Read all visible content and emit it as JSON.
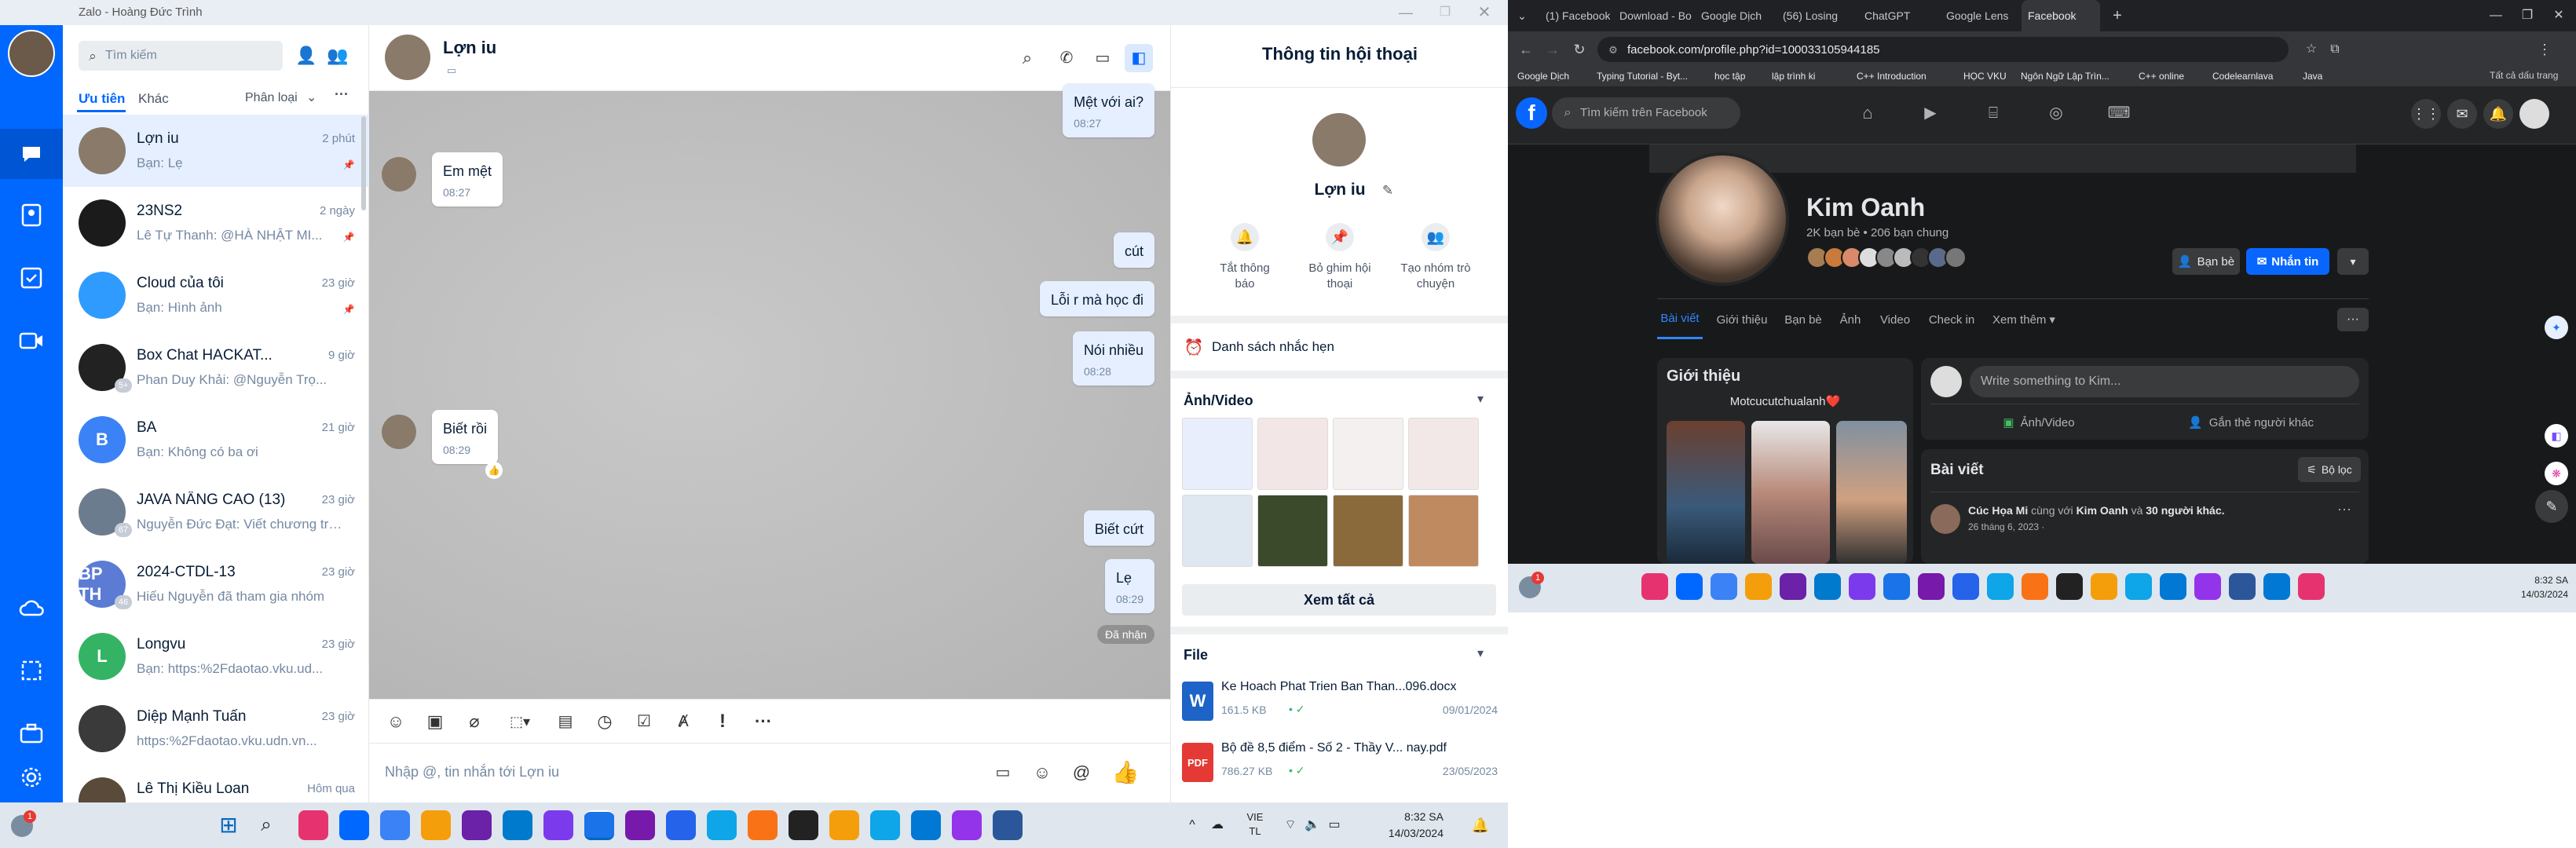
{
  "zalo": {
    "window_title": "Zalo - Hoàng Đức Trình",
    "search_placeholder": "Tìm kiếm",
    "tabs": {
      "priority": "Ưu tiên",
      "other": "Khác",
      "classify": "Phân loại"
    },
    "conversations": [
      {
        "name": "Lợn iu",
        "time": "2 phút",
        "preview": "Bạn: Lẹ",
        "avatar_color": "#8a7a6a",
        "initials": "",
        "pinned": true
      },
      {
        "name": "23NS2",
        "time": "2 ngày",
        "preview": "Lê Tự Thanh: @HÀ NHẬT MI...",
        "avatar_color": "#1b1b1b",
        "initials": "",
        "pinned": true
      },
      {
        "name": "Cloud của tôi",
        "time": "23 giờ",
        "preview": "Bạn: Hình ảnh",
        "avatar_color": "#2f9bff",
        "initials": "",
        "pinned": true
      },
      {
        "name": "Box Chat HACKAT...",
        "time": "9 giờ",
        "preview": "Phan Duy Khải: @Nguyễn Trọ...",
        "avatar_color": "#222222",
        "initials": "",
        "badge": "5+"
      },
      {
        "name": "BA",
        "time": "21 giờ",
        "preview": "Bạn: Không có ba ơi",
        "avatar_color": "#3b82f6",
        "initials": "B"
      },
      {
        "name": "JAVA NÂNG CAO (13)",
        "time": "23 giờ",
        "preview": "Nguyễn Đức Đạt: Viết chương trì...",
        "avatar_color": "#6b7c8f",
        "initials": "",
        "badge": "67"
      },
      {
        "name": "2024-CTDL-13",
        "time": "23 giờ",
        "preview": "Hiếu Nguyễn đã tham gia nhóm",
        "avatar_color": "#5b7bd5",
        "initials": "BP TH",
        "badge": "46"
      },
      {
        "name": "Longvu",
        "time": "23 giờ",
        "preview": "Bạn: https:%2Fdaotao.vku.ud...",
        "avatar_color": "#34b364",
        "initials": "L"
      },
      {
        "name": "Diệp Mạnh Tuấn",
        "time": "23 giờ",
        "preview": "https:%2Fdaotao.vku.udn.vn...",
        "avatar_color": "#3a3a3a",
        "initials": ""
      },
      {
        "name": "Lê Thị Kiều Loan",
        "time": "Hôm qua",
        "preview": "",
        "avatar_color": "#5a4a3a",
        "initials": ""
      }
    ],
    "chat": {
      "name": "Lợn iu",
      "messages": [
        {
          "dir": "out",
          "text": "Mệt với ai?",
          "time": "08:27"
        },
        {
          "dir": "in",
          "text": "Em mệt",
          "time": "08:27"
        },
        {
          "dir": "out",
          "text": "cút",
          "time": ""
        },
        {
          "dir": "out",
          "text": "Lỗi r mà học đi",
          "time": ""
        },
        {
          "dir": "out",
          "text": "Nói nhiều",
          "time": "08:28"
        },
        {
          "dir": "in",
          "text": "Biết rồi",
          "time": "08:29"
        },
        {
          "dir": "out",
          "text": "Biết cứt",
          "time": ""
        },
        {
          "dir": "out",
          "text": "Lẹ",
          "time": "08:29"
        }
      ],
      "received_label": "Đã nhận",
      "input_placeholder": "Nhập @, tin nhắn tới Lợn iu"
    },
    "info": {
      "title": "Thông tin hội thoại",
      "name": "Lợn iu",
      "actions": [
        "Tắt thông báo",
        "Bỏ ghim hội thoại",
        "Tạo nhóm trò chuyện"
      ],
      "reminders": "Danh sách nhắc hẹn",
      "media_title": "Ảnh/Video",
      "view_all": "Xem tất cả",
      "file_title": "File",
      "files": [
        {
          "name": "Ke Hoach Phat Trien Ban Than...096.docx",
          "size": "161.5 KB",
          "date": "09/01/2024",
          "type": "W",
          "color": "#1e63c7"
        },
        {
          "name": "Bộ đề 8,5 điểm - Số 2 - Thầy V...  nay.pdf",
          "size": "786.27 KB",
          "date": "23/05/2023",
          "type": "PDF",
          "color": "#e53935"
        }
      ]
    },
    "taskbar": {
      "lang": "VIE",
      "lang2": "TL",
      "time": "8:32 SA",
      "date": "14/03/2024"
    }
  },
  "browser": {
    "tabs": [
      "(1) Facebook",
      "Download - Boo",
      "Google Dịch",
      "(56) Losing",
      "ChatGPT",
      "Google Lens",
      "Facebook"
    ],
    "url": "facebook.com/profile.php?id=100033105944185",
    "bookmarks": [
      "Google Dịch",
      "Typing Tutorial - Byt...",
      "học tập",
      "lập trình ki",
      "C++ Introduction",
      "HỌC VKU",
      "Ngôn Ngữ Lập Trìn...",
      "C++ online",
      "Codelearnlava",
      "Java"
    ],
    "bookmarks_right": "Tất cả dấu trang"
  },
  "facebook": {
    "search_placeholder": "Tìm kiếm trên Facebook",
    "profile_name": "Kim Oanh",
    "friends_text": "2K bạn bè • 206 bạn chung",
    "btn_friends": "Bạn bè",
    "btn_message": "Nhắn tin",
    "tabs": [
      "Bài viết",
      "Giới thiệu",
      "Bạn bè",
      "Ảnh",
      "Video",
      "Check in",
      "Xem thêm"
    ],
    "intro_title": "Giới thiệu",
    "bio": "Motcucutchualanh❤️",
    "composer_placeholder": "Write something to Kim...",
    "photo_video": "Ảnh/Video",
    "tag_people": "Gắn thẻ người khác",
    "posts_title": "Bài viết",
    "filter": "Bộ lọc",
    "post_author": "Cúc Họa Mi",
    "post_with": "cùng với",
    "post_name2": "Kim Oanh",
    "post_and": "và",
    "post_others": "30 người khác.",
    "post_date": "26 tháng 6, 2023 · ",
    "taskbar_time": "8:32 SA",
    "taskbar_date": "14/03/2024"
  },
  "colors": {
    "zalo_blue": "#0068ff",
    "fb_blue": "#0866ff",
    "fb_bg": "#18191a",
    "fb_card": "#242526"
  }
}
